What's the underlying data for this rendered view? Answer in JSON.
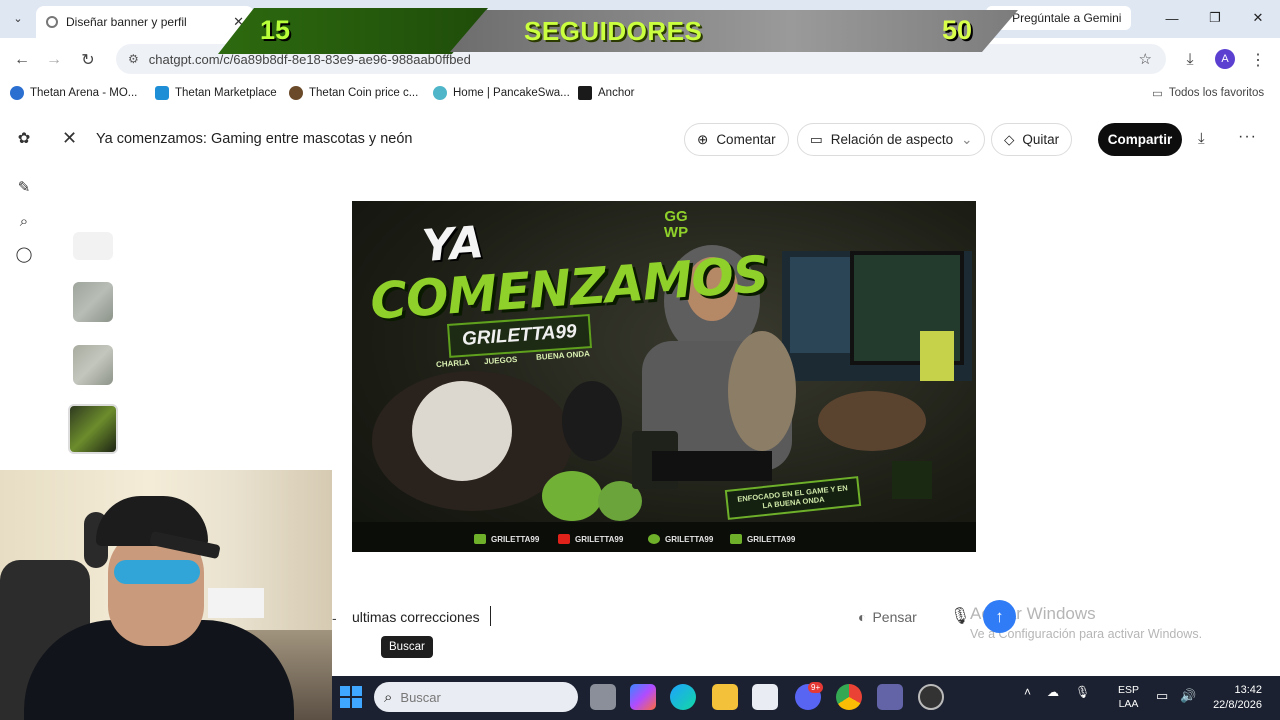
{
  "browser": {
    "tab_title": "Diseñar banner y perfil",
    "tab_close": "✕",
    "gemini_label": "Pregúntale a Gemini",
    "url": "chatgpt.com/c/6a89b8df-8e18-83e9-ae96-988aab0ffbed",
    "avatar_letter": "A",
    "bookmarks": [
      {
        "label": "Thetan Arena - MO..."
      },
      {
        "label": "Thetan Marketplace"
      },
      {
        "label": "Thetan Coin price c..."
      },
      {
        "label": "Home | PancakeSwa..."
      },
      {
        "label": "Anchor"
      }
    ],
    "all_favorites": "Todos los favoritos"
  },
  "app": {
    "page_title": "Ya comenzamos: Gaming entre mascotas y neón",
    "comment_label": "Comentar",
    "aspect_label": "Relación de aspecto",
    "remove_label": "Quitar",
    "share_label": "Compartir"
  },
  "banner": {
    "line1": "YA",
    "line2": "COMENZAMOS",
    "name": "GRILETTA99",
    "tags": [
      "CHARLA",
      "JUEGOS",
      "BUENA ONDA"
    ],
    "ggwp": "GG WP",
    "hud_text": "ENFOCADO EN EL GAME Y EN LA BUENA ONDA",
    "socials": [
      "GRILETTA99",
      "GRILETTA99",
      "GRILETTA99",
      "GRILETTA99"
    ],
    "social_colors": [
      "#6fb02a",
      "#e0221b",
      "#6fb02a",
      "#6fb02a"
    ]
  },
  "prompt": {
    "text": "ultimas correcciones",
    "think_label": "Pensar",
    "tooltip": "Buscar"
  },
  "watermark": {
    "line1": "Activar Windows",
    "line2": "Ve a Configuración para activar Windows."
  },
  "taskbar": {
    "search_placeholder": "Buscar",
    "lang_1": "ESP",
    "lang_2": "LAA",
    "time": "13:42",
    "date": "22/8/2026",
    "discord_badge": "9+"
  },
  "overlay": {
    "left_number": "15",
    "title": "SEGUIDORES",
    "right_number": "50"
  },
  "colors": {
    "accent_green": "#8fd12a",
    "send_blue": "#2f7cf6",
    "share_black": "#0d0d0d"
  }
}
